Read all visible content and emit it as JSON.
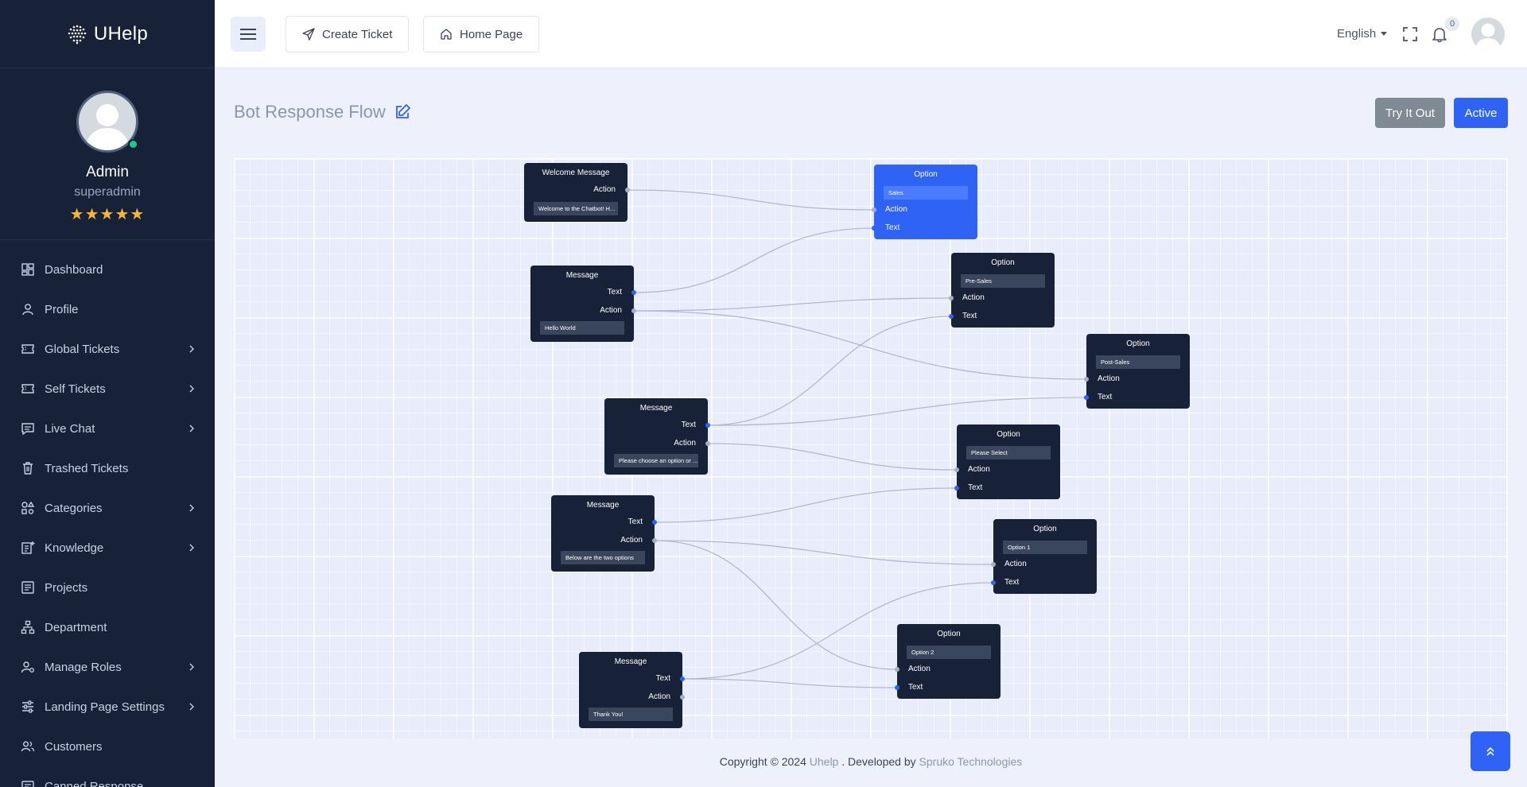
{
  "brand": {
    "name": "UHelp"
  },
  "profile": {
    "name": "Admin",
    "role": "superadmin",
    "stars": "★★★★★"
  },
  "sidebar": {
    "items": [
      {
        "label": "Dashboard",
        "icon": "dashboard-icon",
        "has_submenu": false
      },
      {
        "label": "Profile",
        "icon": "user-icon",
        "has_submenu": false
      },
      {
        "label": "Global Tickets",
        "icon": "ticket-icon",
        "has_submenu": true
      },
      {
        "label": "Self Tickets",
        "icon": "ticket-icon",
        "has_submenu": true
      },
      {
        "label": "Live Chat",
        "icon": "chat-icon",
        "has_submenu": true
      },
      {
        "label": "Trashed Tickets",
        "icon": "trash-icon",
        "has_submenu": false
      },
      {
        "label": "Categories",
        "icon": "categories-icon",
        "has_submenu": true
      },
      {
        "label": "Knowledge",
        "icon": "knowledge-icon",
        "has_submenu": true
      },
      {
        "label": "Projects",
        "icon": "projects-icon",
        "has_submenu": false
      },
      {
        "label": "Department",
        "icon": "department-icon",
        "has_submenu": false
      },
      {
        "label": "Manage Roles",
        "icon": "roles-icon",
        "has_submenu": true
      },
      {
        "label": "Landing Page Settings",
        "icon": "sliders-icon",
        "has_submenu": true
      },
      {
        "label": "Customers",
        "icon": "customers-icon",
        "has_submenu": false
      },
      {
        "label": "Canned Response",
        "icon": "canned-icon",
        "has_submenu": false
      }
    ]
  },
  "header": {
    "create_ticket": "Create Ticket",
    "home_page": "Home Page",
    "language": "English",
    "notification_count": "0"
  },
  "page": {
    "title": "Bot Response Flow",
    "try_button": "Try It Out",
    "active_button": "Active"
  },
  "flow": {
    "labels": {
      "action": "Action",
      "text": "Text"
    },
    "nodes": [
      {
        "id": "welcome",
        "type": "welcome",
        "title": "Welcome Message",
        "value": "Welcome to the Chatbot! H..."
      },
      {
        "id": "msg1",
        "type": "message",
        "title": "Message",
        "value": "Hello World"
      },
      {
        "id": "msg2",
        "type": "message",
        "title": "Message",
        "value": "Please choose an option or ..."
      },
      {
        "id": "msg3",
        "type": "message",
        "title": "Message",
        "value": "Below are the two options"
      },
      {
        "id": "msg4",
        "type": "message",
        "title": "Message",
        "value": "Thank You!"
      },
      {
        "id": "opt_sales",
        "type": "option",
        "title": "Option",
        "value": "Sales",
        "selected": true
      },
      {
        "id": "opt_presales",
        "type": "option",
        "title": "Option",
        "value": "Pre-Sales"
      },
      {
        "id": "opt_postsales",
        "type": "option",
        "title": "Option",
        "value": "Post-Sales"
      },
      {
        "id": "opt_select",
        "type": "option",
        "title": "Option",
        "value": "Please Select"
      },
      {
        "id": "opt_1",
        "type": "option",
        "title": "Option",
        "value": "Option 1"
      },
      {
        "id": "opt_2",
        "type": "option",
        "title": "Option",
        "value": "Option 2"
      }
    ],
    "connections": [
      {
        "from": "welcome",
        "from_port": "action",
        "to": "opt_sales",
        "to_port": "action"
      },
      {
        "from": "msg1",
        "from_port": "text",
        "to": "opt_sales",
        "to_port": "text"
      },
      {
        "from": "msg1",
        "from_port": "action",
        "to": "opt_presales",
        "to_port": "action"
      },
      {
        "from": "msg1",
        "from_port": "action",
        "to": "opt_postsales",
        "to_port": "action"
      },
      {
        "from": "msg2",
        "from_port": "text",
        "to": "opt_presales",
        "to_port": "text"
      },
      {
        "from": "msg2",
        "from_port": "text",
        "to": "opt_postsales",
        "to_port": "text"
      },
      {
        "from": "msg2",
        "from_port": "action",
        "to": "opt_select",
        "to_port": "action"
      },
      {
        "from": "msg3",
        "from_port": "text",
        "to": "opt_select",
        "to_port": "text"
      },
      {
        "from": "msg3",
        "from_port": "action",
        "to": "opt_1",
        "to_port": "action"
      },
      {
        "from": "msg3",
        "from_port": "action",
        "to": "opt_2",
        "to_port": "action"
      },
      {
        "from": "msg4",
        "from_port": "text",
        "to": "opt_1",
        "to_port": "text"
      },
      {
        "from": "msg4",
        "from_port": "text",
        "to": "opt_2",
        "to_port": "text"
      }
    ]
  },
  "footer": {
    "prefix": "Copyright © 2024",
    "brand_link": "Uhelp",
    "middle": ". Developed by",
    "company_link": "Spruko Technologies"
  },
  "colors": {
    "sidebar": "#172239",
    "accent": "#2f63f5",
    "star": "#f7b731",
    "online": "#1cc88a"
  }
}
